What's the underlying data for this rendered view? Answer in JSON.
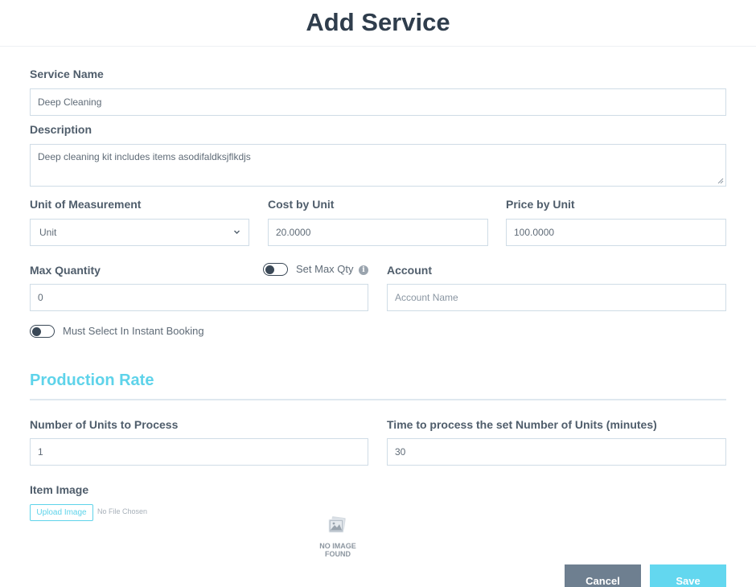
{
  "page": {
    "title": "Add Service"
  },
  "form": {
    "service_name": {
      "label": "Service Name",
      "value": "Deep Cleaning"
    },
    "description": {
      "label": "Description",
      "value": "Deep cleaning kit includes items asodifaldksjflkdjs"
    },
    "unit_of_measurement": {
      "label": "Unit of Measurement",
      "selected": "Unit"
    },
    "cost_by_unit": {
      "label": "Cost by Unit",
      "value": "20.0000"
    },
    "price_by_unit": {
      "label": "Price by Unit",
      "value": "100.0000"
    },
    "max_quantity": {
      "label": "Max Quantity",
      "value": "0"
    },
    "set_max_qty": {
      "label": "Set Max Qty",
      "enabled": false
    },
    "account": {
      "label": "Account",
      "placeholder": "Account Name"
    },
    "instant_booking": {
      "label": "Must Select In Instant Booking",
      "enabled": false
    }
  },
  "production_rate": {
    "title": "Production Rate",
    "units_to_process": {
      "label": "Number of Units to Process",
      "value": "1"
    },
    "time_to_process": {
      "label": "Time to process the set Number of Units (minutes)",
      "value": "30"
    }
  },
  "item_image": {
    "label": "Item Image",
    "upload_label": "Upload Image",
    "no_file_text": "No File Chosen",
    "no_image_line1": "NO IMAGE",
    "no_image_line2": "FOUND"
  },
  "actions": {
    "cancel_label": "Cancel",
    "save_label": "Save"
  },
  "colors": {
    "accent": "#5ed3ea",
    "title": "#2f3d4c",
    "cancel": "#6e7f90",
    "save": "#63d7ef",
    "border": "#cfdce6"
  }
}
